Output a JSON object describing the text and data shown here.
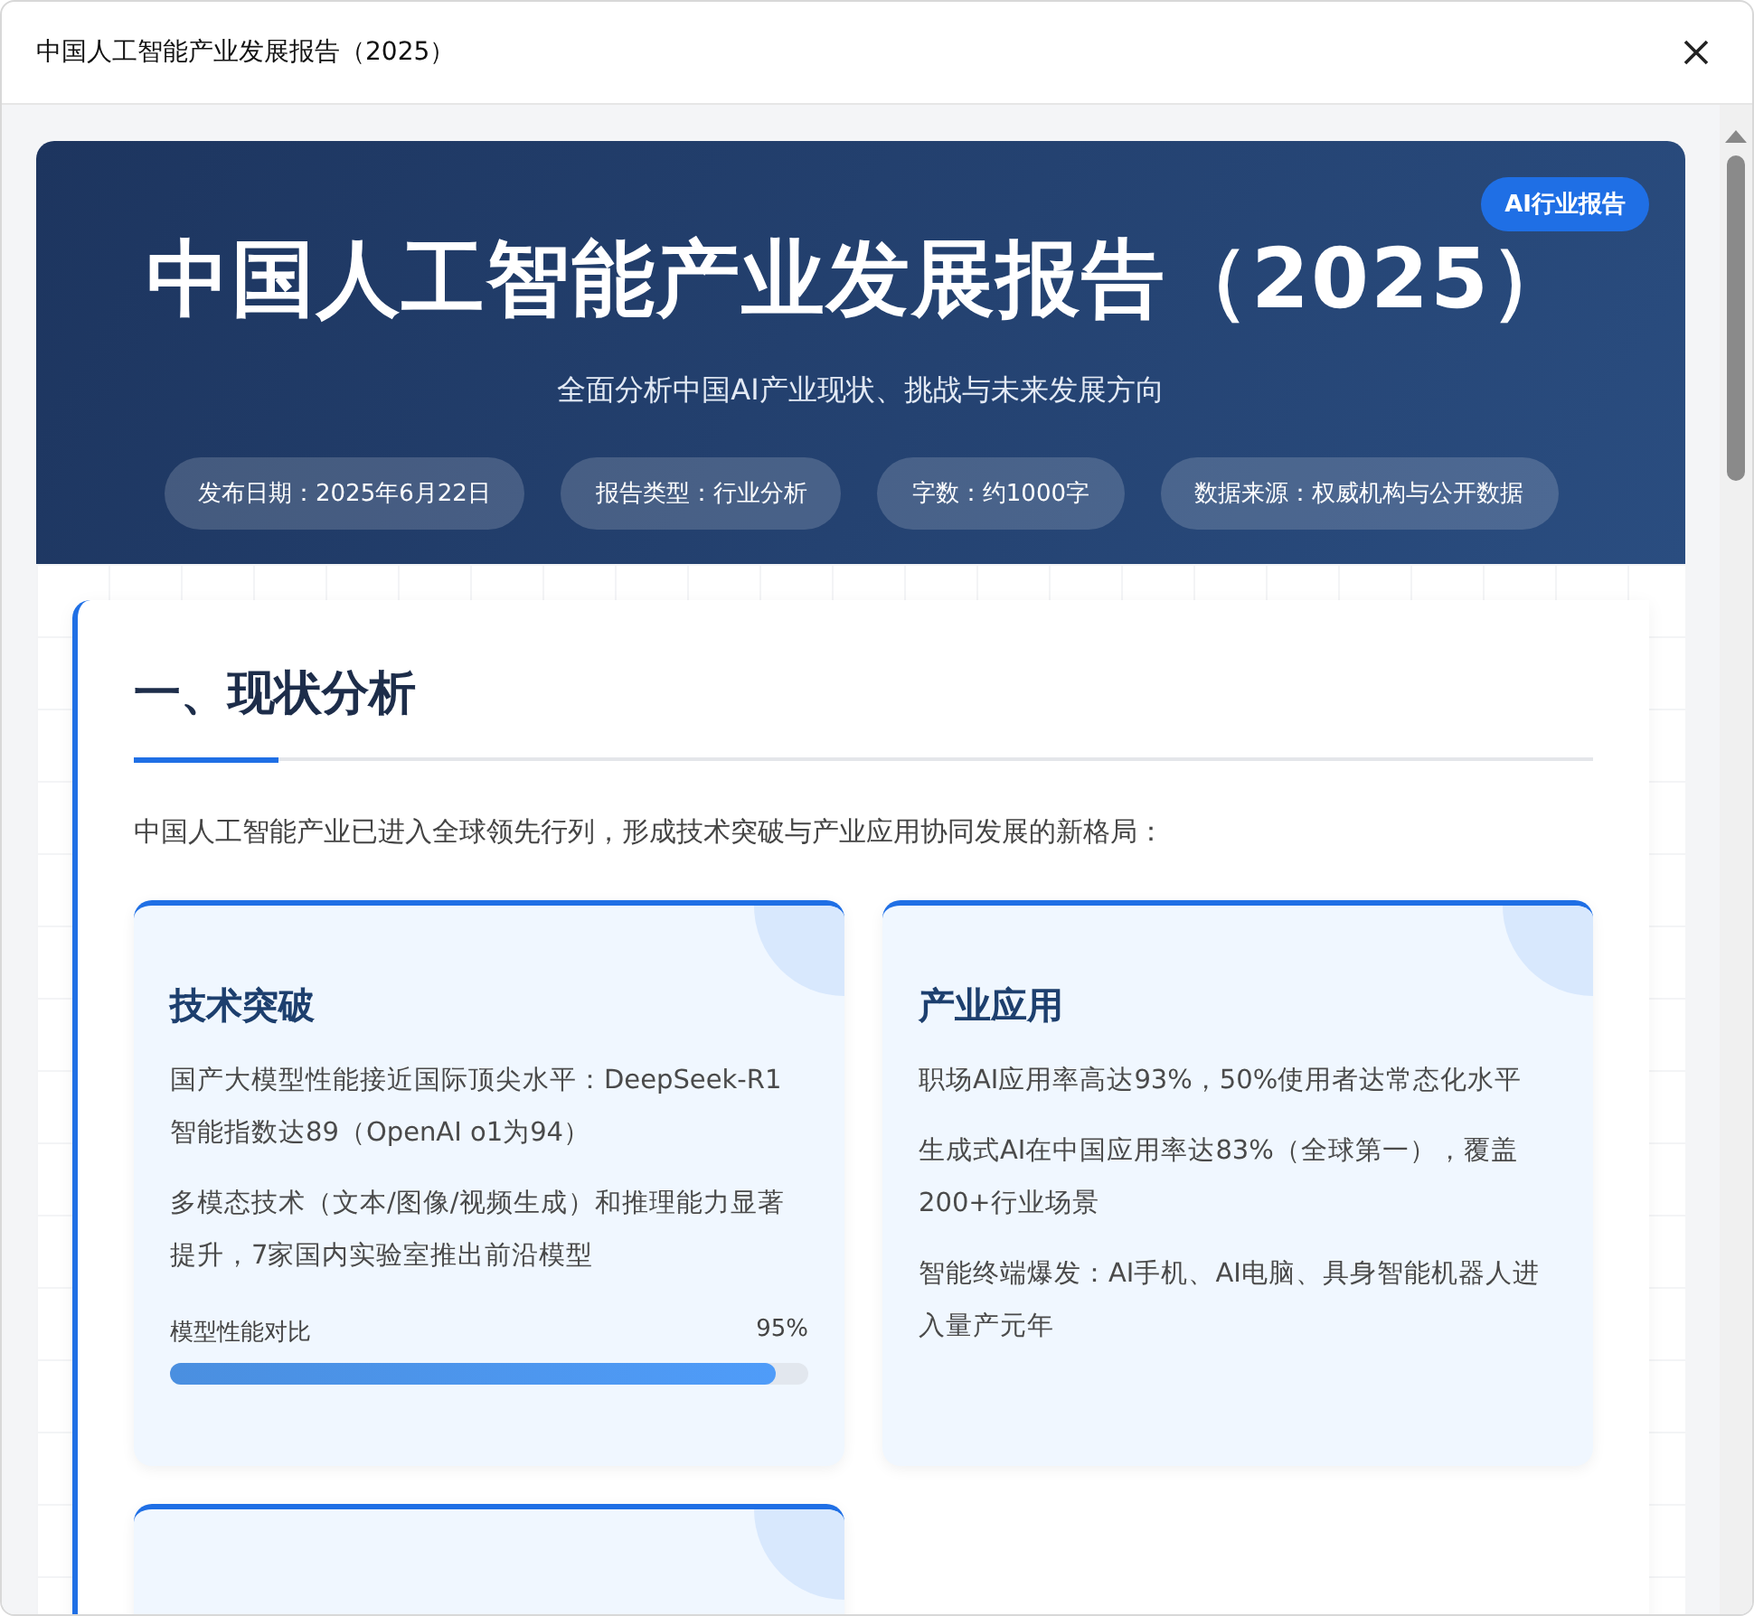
{
  "window": {
    "title": "中国人工智能产业发展报告（2025）"
  },
  "header": {
    "badge": "AI行业报告",
    "title": "中国人工智能产业发展报告（2025）",
    "subtitle": "全面分析中国AI产业现状、挑战与未来发展方向",
    "meta": [
      "发布日期：2025年6月22日",
      "报告类型：行业分析",
      "字数：约1000字",
      "数据来源：权威机构与公开数据"
    ]
  },
  "section": {
    "heading": "一、现状分析",
    "intro": "中国人工智能产业已进入全球领先行列，形成技术突破与产业应用协同发展的新格局：",
    "cards": [
      {
        "kind": "full",
        "title": "技术突破",
        "points": [
          "国产大模型性能接近国际顶尖水平：DeepSeek-R1智能指数达89（OpenAI o1为94）",
          "多模态技术（文本/图像/视频生成）和推理能力显著提升，7家国内实验室推出前沿模型"
        ],
        "progress": {
          "label": "模型性能对比",
          "reading": "95%",
          "level": 0.95
        }
      },
      {
        "kind": "full",
        "title": "产业应用",
        "points": [
          "职场AI应用率高达93%，50%使用者达常态化水平",
          "生成式AI在中国应用率达83%（全球第一），覆盖200+行业场景",
          "智能终端爆发：AI手机、AI电脑、具身智能机器人进入量产元年"
        ]
      },
      {
        "kind": "clipped"
      }
    ]
  }
}
